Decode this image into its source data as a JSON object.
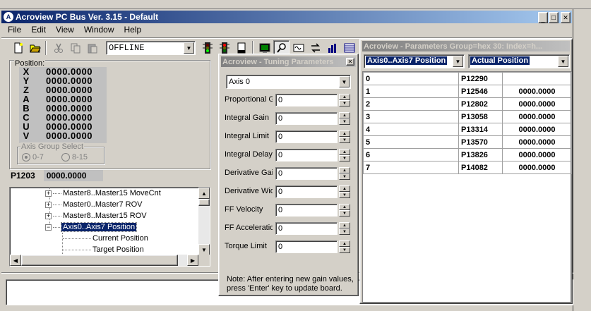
{
  "app": {
    "title": "Acroview PC Bus Ver. 3.15 - Default",
    "window_controls": [
      "_",
      "□",
      "✕"
    ]
  },
  "menu": [
    "File",
    "Edit",
    "View",
    "Window",
    "Help"
  ],
  "toolbar": {
    "mode_value": "OFFLINE"
  },
  "position_panel": {
    "label": "Position:",
    "axes": [
      {
        "axis": "X",
        "value": "0000.0000"
      },
      {
        "axis": "Y",
        "value": "0000.0000"
      },
      {
        "axis": "Z",
        "value": "0000.0000"
      },
      {
        "axis": "A",
        "value": "0000.0000"
      },
      {
        "axis": "B",
        "value": "0000.0000"
      },
      {
        "axis": "C",
        "value": "0000.0000"
      },
      {
        "axis": "U",
        "value": "0000.0000"
      },
      {
        "axis": "V",
        "value": "0000.0000"
      }
    ],
    "group_select_label": "Axis Group Select",
    "group_options": [
      "0-7",
      "8-15"
    ],
    "selected_group": "0-7",
    "param_name": "P1203",
    "param_value": "0000.0000"
  },
  "tree": {
    "items": [
      {
        "label": "Master8..Master15 MoveCnt",
        "expander": "+",
        "selected": false,
        "level": 1
      },
      {
        "label": "Master0..Master7 ROV",
        "expander": "+",
        "selected": false,
        "level": 1
      },
      {
        "label": "Master8..Master15 ROV",
        "expander": "+",
        "selected": false,
        "level": 1
      },
      {
        "label": "Axis0..Axis7  Position",
        "expander": "−",
        "selected": true,
        "level": 1
      },
      {
        "label": "Current Position",
        "expander": "",
        "selected": false,
        "level": 2
      },
      {
        "label": "Target Position",
        "expander": "",
        "selected": false,
        "level": 2
      }
    ]
  },
  "tuning": {
    "title": "Acroview - Tuning Parameters",
    "axis_value": "Axis 0",
    "params": [
      {
        "label": "Proportional Gain",
        "value": "0"
      },
      {
        "label": "Integral Gain",
        "value": "0"
      },
      {
        "label": "Integral Limit",
        "value": "0"
      },
      {
        "label": "Integral Delay",
        "value": "0"
      },
      {
        "label": "Derivative Gain",
        "value": "0"
      },
      {
        "label": "Derivative Width",
        "value": "0"
      },
      {
        "label": "FF Velocity",
        "value": "0"
      },
      {
        "label": "FF Acceleration",
        "value": "0"
      },
      {
        "label": "Torque Limit",
        "value": "0"
      }
    ],
    "note_line1": "Note: After entering new gain values,",
    "note_line2": "press 'Enter' key to update board."
  },
  "params_group": {
    "title": "Acroview - Parameters Group=hex 30: Index=h...",
    "group_value": "Axis0..Axis7  Position",
    "type_value": "Actual Position",
    "rows": [
      {
        "index": "0",
        "param": "P12290",
        "value": ""
      },
      {
        "index": "1",
        "param": "P12546",
        "value": "0000.0000"
      },
      {
        "index": "2",
        "param": "P12802",
        "value": "0000.0000"
      },
      {
        "index": "3",
        "param": "P13058",
        "value": "0000.0000"
      },
      {
        "index": "4",
        "param": "P13314",
        "value": "0000.0000"
      },
      {
        "index": "5",
        "param": "P13570",
        "value": "0000.0000"
      },
      {
        "index": "6",
        "param": "P13826",
        "value": "0000.0000"
      },
      {
        "index": "7",
        "param": "P14082",
        "value": "0000.0000"
      }
    ]
  },
  "colors": {
    "title_active": "#0a246a",
    "title_inactive": "#808080",
    "face": "#d4d0c8",
    "selection": "#0a246a"
  }
}
